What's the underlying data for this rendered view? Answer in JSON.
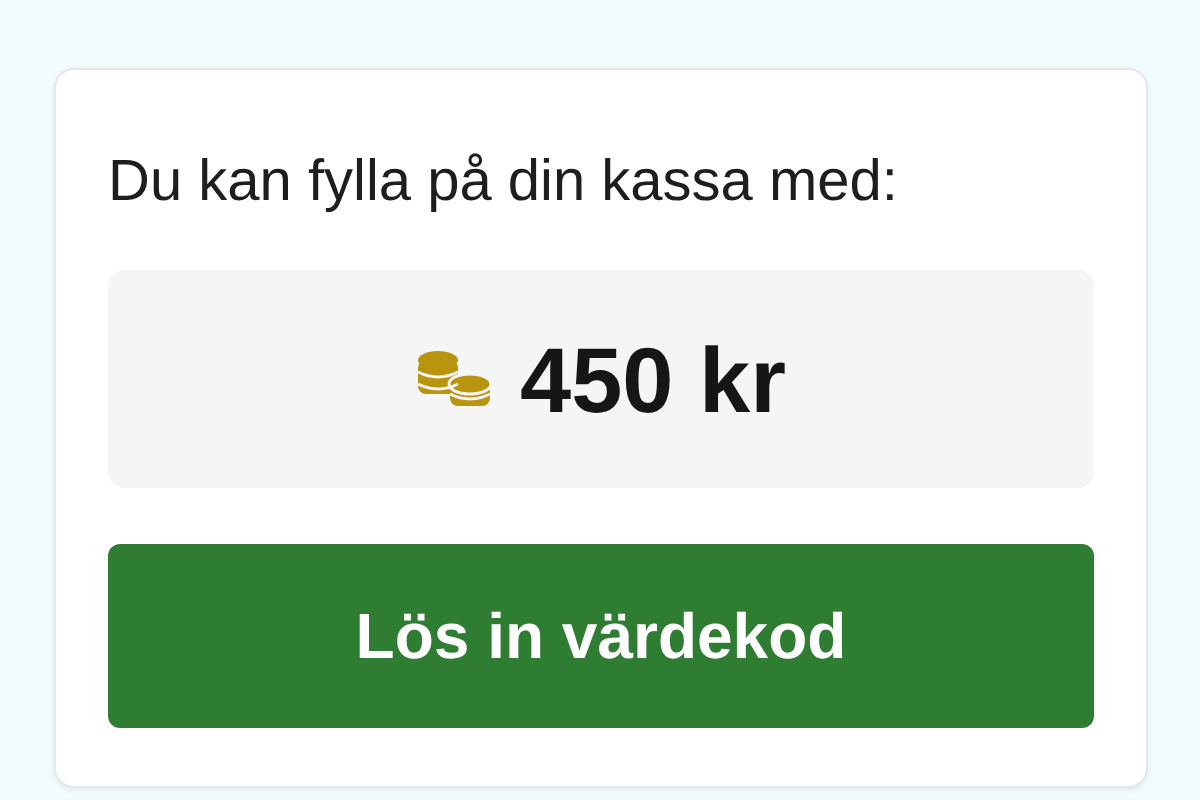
{
  "card": {
    "intro": "Du kan fylla på din kassa med:",
    "amount": "450 kr",
    "button": "Lös in värdekod"
  }
}
